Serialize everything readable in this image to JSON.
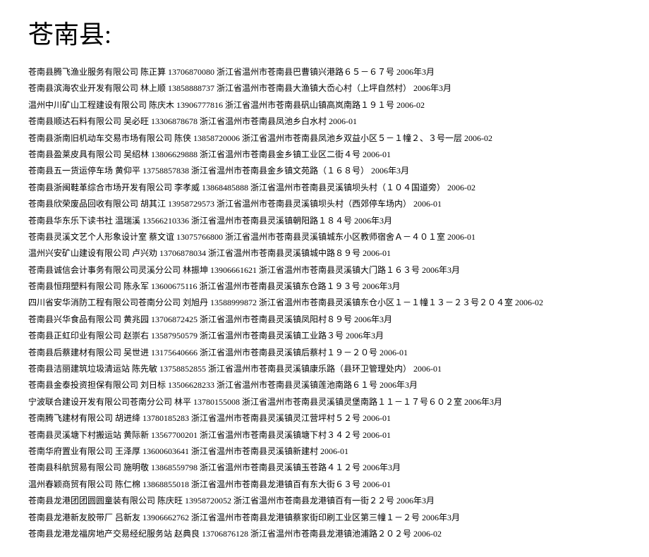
{
  "title": "苍南县:",
  "entries": [
    "苍南县腾飞渔业服务有限公司 陈正算 13706870080 浙江省温州市苍南县巴曹镇兴港路６５－６７号 2006年3月",
    "苍南县滨海农业开发有限公司 林上顺 13858888737 浙江省温州市苍南县大渔镇大岙心村（上坪自然村） 2006年3月",
    "温州中川矿山工程建设有限公司 陈庆木 13906777816 浙江省温州市苍南县矾山镇高岚南路１９１号 2006-02",
    "苍南县顺达石料有限公司 吴必旺 13306878678 浙江省温州市苍南县凤池乡白水村 2006-01",
    "苍南县浙南旧机动车交易市场有限公司 陈侠 13858720006 浙江省温州市苍南县凤池乡双益小区５－１幢２、３号一层 2006-02",
    "苍南县盈莱皮具有限公司 吴绍林 13806629888 浙江省温州市苍南县金乡镇工业区二街４号 2006-01",
    "苍南县五一货运停车场 黄仰平 13758857838 浙江省温州市苍南县金乡镇文苑路（１６８号） 2006年3月",
    "苍南县浙闽鞋革综合市场开发有限公司 李孝威 13868485888 浙江省温州市苍南县灵溪镇坝头村（１０４国道旁） 2006-02",
    "苍南县欣荣废品回收有限公司 胡其江 13958729573 浙江省温州市苍南县灵溪镇坝头村（西郊停车场内） 2006-01",
    "苍南县华东乐下读书社 温瑞溪 13566210336 浙江省温州市苍南县灵溪镇朝阳路１８４号 2006年3月",
    "苍南县灵溪文艺个人形象设计室 蔡文谊 13075766800 浙江省温州市苍南县灵溪镇城东小区教师宿舍Ａ－４０１室 2006-01",
    "温州兴安矿山建设有限公司 卢兴劝 13706878034 浙江省温州市苍南县灵溪镇城中路８９号 2006-01",
    "苍南县诚信会计事务有限公司灵溪分公司 林振坤 13906661621 浙江省温州市苍南县灵溪镇大门路１６３号 2006年3月",
    "苍南县恒翔塑料有限公司 陈永军 13600675116 浙江省温州市苍南县灵溪镇东仓路１９３号 2006年3月",
    "四川省安华消防工程有限公司苍南分公司 刘旭丹 13588999872 浙江省温州市苍南县灵溪镇东仓小区１－１幢１３－２３号２０４室 2006-02",
    "苍南县兴华食品有限公司 黄兆园 13706872425 浙江省温州市苍南县灵溪镇凤阳村８９号 2006年3月",
    "苍南县正虹印业有限公司 赵崇右 13587950579 浙江省温州市苍南县灵溪镇工业路３号 2006年3月",
    "苍南县后蔡建材有限公司 吴世进 13175640666 浙江省温州市苍南县灵溪镇后蔡村１９－２０号 2006-01",
    "苍南县洁丽建筑垃圾清运站 陈先敏 13758852855 浙江省温州市苍南县灵溪镇康乐路（县环卫管理处内） 2006-01",
    "苍南县金泰投资担保有限公司 刘日标 13506628233 浙江省温州市苍南县灵溪镇莲池南路６１号 2006年3月",
    "宁波联合建设开发有限公司苍南分公司 林平 13780155008 浙江省温州市苍南县灵溪镇灵堡南路１１－１７号６０２室 2006年3月",
    "苍南腾飞建材有限公司 胡进绛 13780185283 浙江省温州市苍南县灵溪镇灵江营坪村５２号 2006-01",
    "苍南县灵溪塘下村搬运站 黄际新 13567700201 浙江省温州市苍南县灵溪镇塘下村３４２号 2006-01",
    "苍南华府置业有限公司 王泽厚 13600603641 浙江省温州市苍南县灵溪镇新建村 2006-01",
    "苍南县科航贸易有限公司 施明敬 13868559798 浙江省温州市苍南县灵溪镇玉苍路４１２号 2006年3月",
    "温州春颖商贸有限公司 陈仁棉 13868855018 浙江省温州市苍南县龙港镇百有东大街６３号 2006-01",
    "苍南县龙港团团圆圆童装有限公司 陈庆旺 13958720052 浙江省温州市苍南县龙港镇百有一街２２号 2006年3月",
    "苍南县龙港新友胶带厂 吕新友 13906662762 浙江省温州市苍南县龙港镇蔡家街印刷工业区第三幢１－２号 2006年3月",
    "苍南县龙港龙福房地产交易经纪服务站 赵典良 13706876128 浙江省温州市苍南县龙港镇池浦路２０２号 2006-02"
  ]
}
